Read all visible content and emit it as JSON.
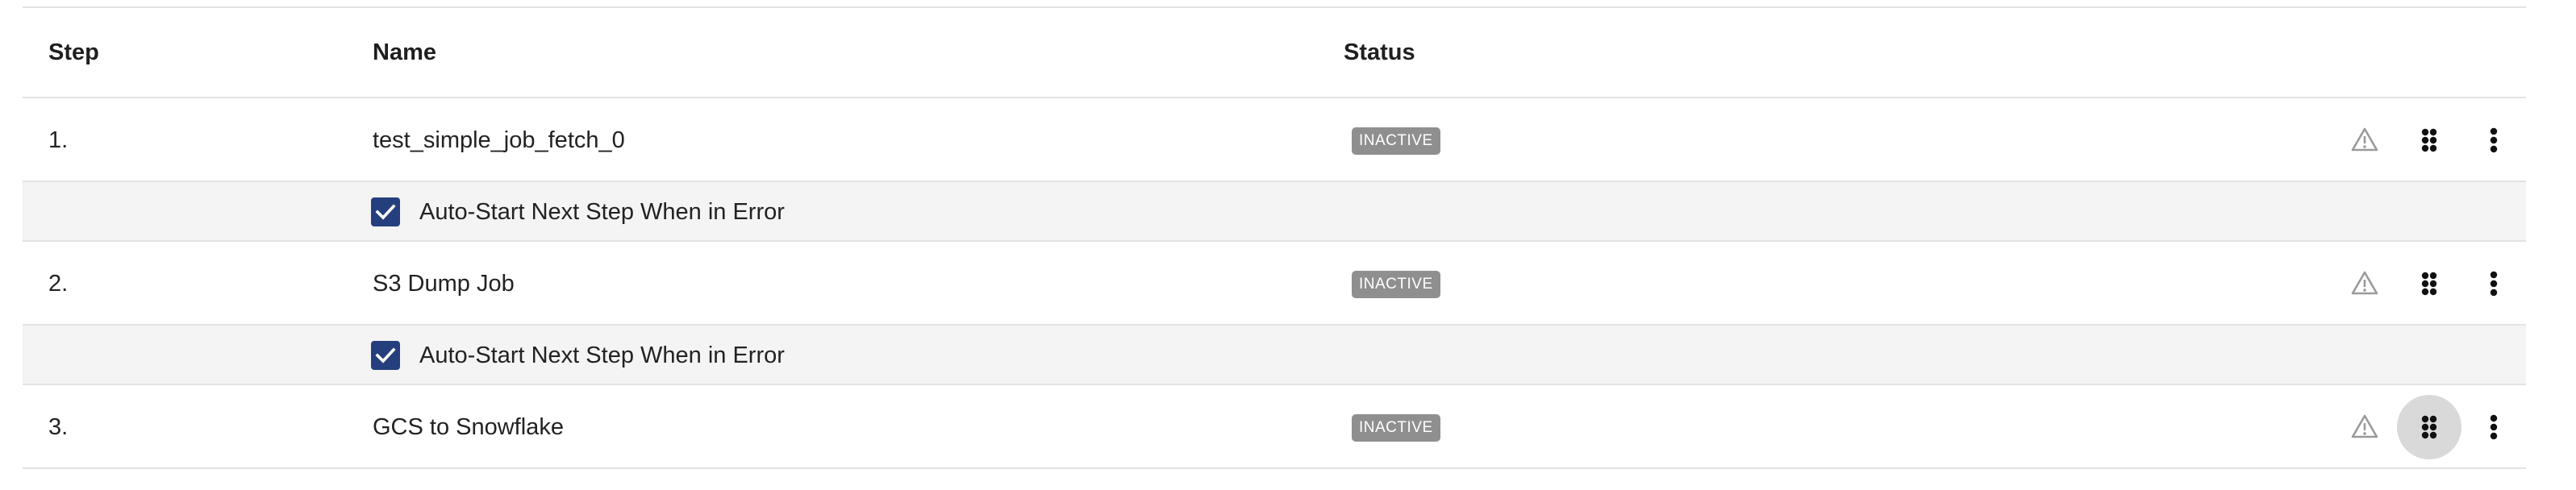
{
  "table": {
    "headers": {
      "step": "Step",
      "name": "Name",
      "status": "Status"
    },
    "rows": [
      {
        "step": "1.",
        "name": "test_simple_job_fetch_0",
        "status": "INACTIVE",
        "auto_start_label": "Auto-Start Next Step When in Error",
        "auto_start_checked": true
      },
      {
        "step": "2.",
        "name": "S3 Dump Job",
        "status": "INACTIVE",
        "auto_start_label": "Auto-Start Next Step When in Error",
        "auto_start_checked": true
      },
      {
        "step": "3.",
        "name": "GCS to Snowflake",
        "status": "INACTIVE"
      }
    ]
  },
  "icons": {
    "warning": "warning-icon",
    "drag": "drag-handle-icon",
    "more": "more-vert-icon"
  },
  "colors": {
    "checkbox": "#253f7e",
    "badge_bg": "#8f8f8f",
    "sub_row_bg": "#f4f4f4",
    "active_hover": "#d9d9d9"
  }
}
